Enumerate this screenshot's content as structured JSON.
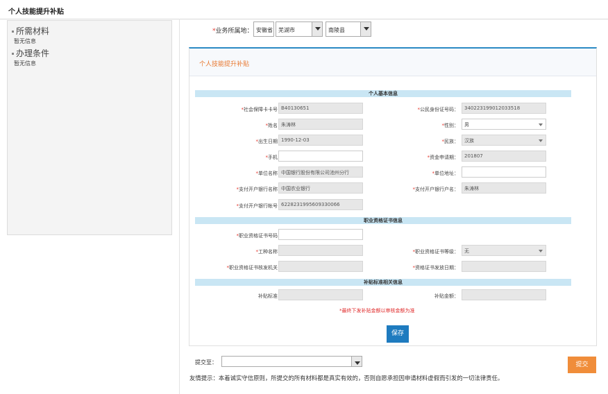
{
  "page_title": "个人技能提升补贴",
  "sidebar": {
    "materials_title": "所需材料",
    "materials_text": "暂无信息",
    "conditions_title": "办理条件",
    "conditions_text": "暂无信息"
  },
  "location": {
    "label": "业务所属地：",
    "province": "安徽省",
    "city": "芜湖市",
    "county": "南陵县"
  },
  "panel_title": "个人技能提升补贴",
  "sections": {
    "basic": "个人基本信息",
    "cert": "职业资格证书信息",
    "subsidy": "补贴标准相关信息"
  },
  "fields": {
    "ss_card_label": "社会保障卡卡号：",
    "ss_card_value": "B40130651",
    "id_label": "公民身份证号码：",
    "id_value": "340223199012033518",
    "name_label": "姓名：",
    "name_value": "朱涛林",
    "gender_label": "性别：",
    "gender_value": "男",
    "birth_label": "出生日期：",
    "birth_value": "1990-12-03",
    "ethnic_label": "民族：",
    "ethnic_value": "汉族",
    "phone_label": "手机：",
    "phone_value": "",
    "fund_date_label": "资金申请期：",
    "fund_date_value": "201807",
    "employer_label": "单位名称：",
    "employer_value": "中国银行股份有限公司池州分行",
    "employer_addr_label": "单位地址：",
    "employer_addr_value": "",
    "bank_name_label": "支付开户银行名称：",
    "bank_name_value": "中国农业银行",
    "bank_holder_label": "支付开户银行户名：",
    "bank_holder_value": "朱涛林",
    "bank_account_label": "支付开户银行帐号：",
    "bank_account_value": "6228231995609330066",
    "cert_no_label": "职业资格证书号码：",
    "cert_no_value": "",
    "job_name_label": "工种名称：",
    "job_name_value": "",
    "cert_level_label": "职业资格证书等级：",
    "cert_level_value": "无",
    "cert_org_label": "职业资格证书核发机关：",
    "cert_org_value": "",
    "cert_date_label": "资格证书发放日期：",
    "cert_date_value": "",
    "subsidy_std_label": "补贴标准：",
    "subsidy_std_value": "",
    "subsidy_amt_label": "补贴金额：",
    "subsidy_amt_value": ""
  },
  "note": "*最终下发补贴金额以审核金额为准",
  "save_label": "保存",
  "submit_to_label": "提交至：",
  "submit_to_value": "",
  "submit_label": "提交",
  "tip": "友情提示：本着诚实守信原则，所提交的所有材料都是真实有效的，否则自愿承担因申请材料虚假而引发的一切法律责任。"
}
